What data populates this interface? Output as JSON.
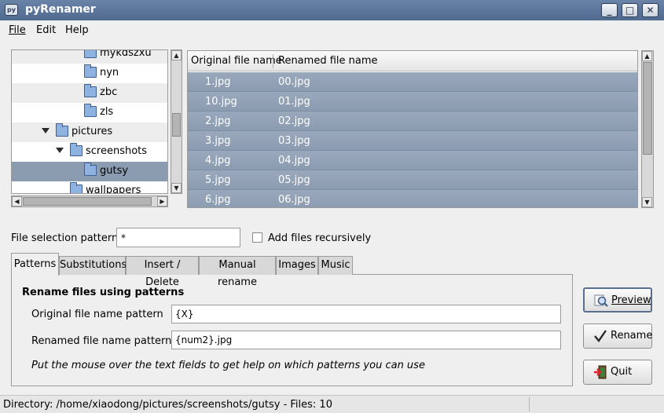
{
  "window": {
    "title": "pyRenamer",
    "app_icon_text": "py",
    "minimize_glyph": "_",
    "maximize_glyph": "□",
    "close_glyph": "✕"
  },
  "menubar": {
    "items": [
      {
        "label": "File"
      },
      {
        "label": "Edit"
      },
      {
        "label": "Help"
      }
    ]
  },
  "folder_tree": {
    "rows": [
      {
        "label": "mykdszxu",
        "depth": 3,
        "expander": "none",
        "selected": false
      },
      {
        "label": "nyn",
        "depth": 3,
        "expander": "none",
        "selected": false
      },
      {
        "label": "zbc",
        "depth": 3,
        "expander": "none",
        "selected": false
      },
      {
        "label": "zls",
        "depth": 3,
        "expander": "none",
        "selected": false
      },
      {
        "label": "pictures",
        "depth": 1,
        "expander": "expanded",
        "selected": false
      },
      {
        "label": "screenshots",
        "depth": 2,
        "expander": "expanded",
        "selected": false
      },
      {
        "label": "gutsy",
        "depth": 3,
        "expander": "none",
        "selected": true
      },
      {
        "label": "wallpapers",
        "depth": 2,
        "expander": "none",
        "selected": false
      }
    ]
  },
  "file_list": {
    "columns": [
      "Original file name",
      "Renamed file name"
    ],
    "rows": [
      {
        "original": "1.jpg",
        "renamed": "00.jpg"
      },
      {
        "original": "10.jpg",
        "renamed": "01.jpg"
      },
      {
        "original": "2.jpg",
        "renamed": "02.jpg"
      },
      {
        "original": "3.jpg",
        "renamed": "03.jpg"
      },
      {
        "original": "4.jpg",
        "renamed": "04.jpg"
      },
      {
        "original": "5.jpg",
        "renamed": "05.jpg"
      },
      {
        "original": "6.jpg",
        "renamed": "06.jpg"
      }
    ]
  },
  "selection": {
    "pattern_label": "File selection pattern",
    "pattern_value": "*",
    "recursive_label": "Add files recursively",
    "recursive_checked": false
  },
  "tabs": [
    {
      "label": "Patterns",
      "active": true
    },
    {
      "label": "Substitutions",
      "active": false
    },
    {
      "label": "Insert / Delete",
      "active": false
    },
    {
      "label": "Manual rename",
      "active": false
    },
    {
      "label": "Images",
      "active": false
    },
    {
      "label": "Music",
      "active": false
    }
  ],
  "patterns_panel": {
    "heading": "Rename files using patterns",
    "original_label": "Original file name pattern",
    "original_value": "{X}",
    "renamed_label": "Renamed file name  pattern",
    "renamed_value": "{num2}.jpg",
    "help_text": "Put the mouse over the text fields to get help on which patterns you can use"
  },
  "buttons": {
    "preview": "Preview",
    "rename": "Rename",
    "quit": "Quit"
  },
  "statusbar": {
    "text": "Directory: /home/xiaodong/pictures/screenshots/gutsy - Files: 10"
  },
  "colors": {
    "titlebar": "#5b7699",
    "selection": "#8b9bb0",
    "panel_bg": "#efefef"
  }
}
